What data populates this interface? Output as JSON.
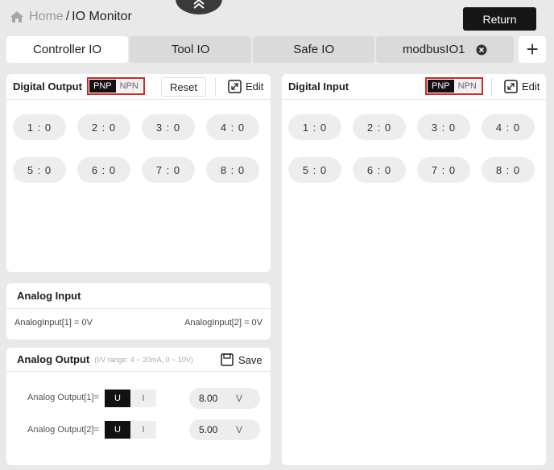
{
  "header": {
    "home": "Home",
    "separator": "/",
    "current": "IO Monitor",
    "return_label": "Return"
  },
  "tabs": [
    {
      "label": "Controller IO",
      "active": true
    },
    {
      "label": "Tool IO",
      "active": false
    },
    {
      "label": "Safe IO",
      "active": false
    },
    {
      "label": "modbusIO1",
      "active": false,
      "closable": true
    }
  ],
  "tab_add_label": "+",
  "digital_output": {
    "title": "Digital Output",
    "toggle": {
      "pnp": "PNP",
      "npn": "NPN",
      "selected": "PNP"
    },
    "reset_label": "Reset",
    "edit_label": "Edit",
    "pins": [
      "1 : 0",
      "2 : 0",
      "3 : 0",
      "4 : 0",
      "5 : 0",
      "6 : 0",
      "7 : 0",
      "8 : 0"
    ]
  },
  "digital_input": {
    "title": "Digital Input",
    "toggle": {
      "pnp": "PNP",
      "npn": "NPN",
      "selected": "PNP"
    },
    "edit_label": "Edit",
    "pins": [
      "1 : 0",
      "2 : 0",
      "3 : 0",
      "4 : 0",
      "5 : 0",
      "6 : 0",
      "7 : 0",
      "8 : 0"
    ]
  },
  "analog_input": {
    "title": "Analog Input",
    "values": [
      "AnalogInput[1] = 0V",
      "AnalogInput[2] = 0V"
    ]
  },
  "analog_output": {
    "title": "Analog Output",
    "range_note": "(I/V range: 4 ~ 20mA, 0 ~ 10V)",
    "save_label": "Save",
    "rows": [
      {
        "label": "Analog Output[1]=",
        "u": "U",
        "i": "I",
        "value": "8.00",
        "unit": "V"
      },
      {
        "label": "Analog Output[2]=",
        "u": "U",
        "i": "I",
        "value": "5.00",
        "unit": "V"
      }
    ]
  },
  "colors": {
    "accent_dark": "#111111",
    "highlight_red": "#d9232a",
    "background": "#e9e9ea"
  },
  "icons": {
    "home": "home-icon",
    "collapse": "double-chevron-up-icon",
    "close": "close-circle-icon",
    "edit": "expand-icon",
    "save": "save-icon"
  }
}
